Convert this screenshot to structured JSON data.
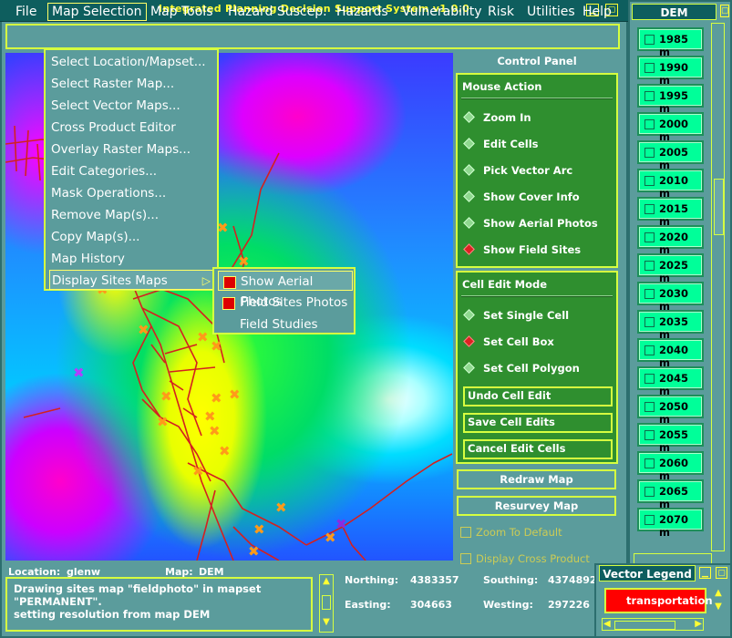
{
  "window": {
    "title": "Integrated Planning Decision Support System v1.0.0"
  },
  "menubar": [
    {
      "label": "File"
    },
    {
      "label": "Map Selection"
    },
    {
      "label": "Map Tools"
    },
    {
      "label": "Hazard Suscep."
    },
    {
      "label": "Hazards"
    },
    {
      "label": "Vulnerability"
    },
    {
      "label": "Risk"
    },
    {
      "label": "Utilities"
    },
    {
      "label": "Help"
    }
  ],
  "dropdown": {
    "items": [
      "Select Location/Mapset...",
      "Select Raster Map...",
      "Select Vector Maps...",
      "Cross Product Editor",
      "Overlay Raster Maps...",
      "Edit Categories...",
      "Mask Operations...",
      "Remove Map(s)...",
      "Copy Map(s)...",
      "Map History",
      "Display Sites Maps"
    ],
    "submenu_arrow": "▷"
  },
  "submenu": {
    "items": [
      {
        "label": "Show Aerial Photos",
        "checked": true
      },
      {
        "label": "Field Sites Photos",
        "checked": true
      },
      {
        "label": "Field Studies",
        "checked": false
      }
    ]
  },
  "control_panel": {
    "title": "Control Panel",
    "mouse_action": {
      "title": "Mouse Action",
      "options": [
        {
          "label": "Zoom In",
          "selected": false
        },
        {
          "label": "Edit Cells",
          "selected": false
        },
        {
          "label": "Pick Vector Arc",
          "selected": false
        },
        {
          "label": "Show Cover Info",
          "selected": false
        },
        {
          "label": "Show Aerial Photos",
          "selected": false
        },
        {
          "label": "Show Field Sites",
          "selected": true
        }
      ]
    },
    "cell_edit_mode": {
      "title": "Cell Edit Mode",
      "options": [
        {
          "label": "Set Single Cell",
          "selected": false
        },
        {
          "label": "Set Cell Box",
          "selected": true
        },
        {
          "label": "Set Cell Polygon",
          "selected": false
        }
      ],
      "buttons": [
        "Undo Cell Edit",
        "Save Cell Edits",
        "Cancel Edit Cells"
      ]
    },
    "redraw_label": "Redraw Map",
    "resurvey_label": "Resurvey Map",
    "zoom_default_label": "Zoom To Default",
    "cross_product_label": "Display Cross Product"
  },
  "status": {
    "location_label": "Location:",
    "location_value": "glenw",
    "map_label": "Map:",
    "map_value": "DEM",
    "messages": [
      "Drawing sites map \"fieldphoto\" in mapset",
      "\"PERMANENT\".",
      "setting resolution from map DEM"
    ],
    "northing_label": "Northing:",
    "northing_value": "4383357",
    "southing_label": "Southing:",
    "southing_value": "4374892",
    "easting_label": "Easting:",
    "easting_value": "304663",
    "westing_label": "Westing:",
    "westing_value": "297226"
  },
  "dem_legend": {
    "title": "DEM",
    "items": [
      "1985 m",
      "1990 m",
      "1995 m",
      "2000 m",
      "2005 m",
      "2010 m",
      "2015 m",
      "2020 m",
      "2025 m",
      "2030 m",
      "2035 m",
      "2040 m",
      "2045 m",
      "2050 m",
      "2055 m",
      "2060 m",
      "2065 m",
      "2070 m"
    ],
    "color": "#00ff99"
  },
  "vector_legend": {
    "title": "Vector Legend",
    "item": "transportation",
    "color": "#ff0000"
  },
  "colors": {
    "accent": "#d6ff40",
    "panel_green": "#2f8f2f",
    "title_text": "#ffff33"
  }
}
